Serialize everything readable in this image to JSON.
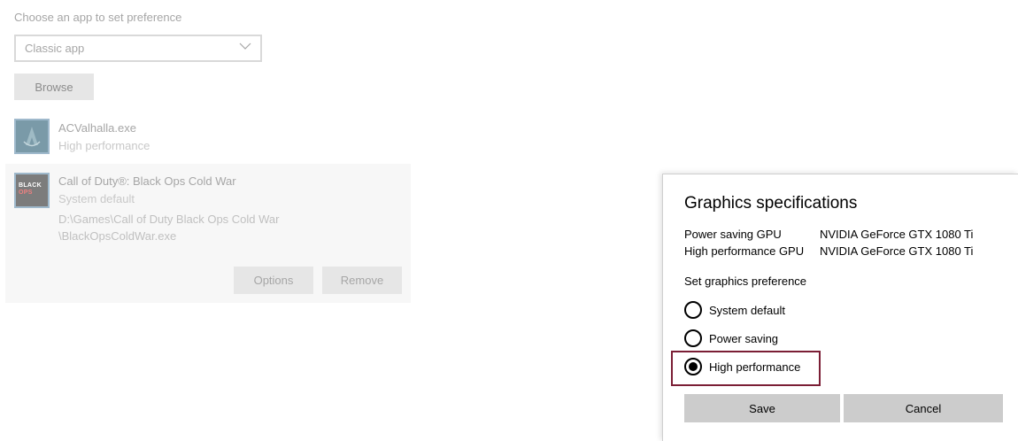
{
  "settings": {
    "choose_label": "Choose an app to set preference",
    "app_type_select": {
      "selected": "Classic app",
      "icon": "chevron-down-icon"
    },
    "browse_label": "Browse",
    "apps": [
      {
        "name": "ACValhalla.exe",
        "preference": "High performance",
        "icon": "assassins-creed-app-icon"
      },
      {
        "name": "Call of Duty®: Black Ops Cold War",
        "preference": "System default",
        "path_line1": "D:\\Games\\Call of Duty Black Ops Cold War",
        "path_line2": "\\BlackOpsColdWar.exe",
        "icon_text_top": "BLACK",
        "icon_text_bottom": "OPS",
        "options_label": "Options",
        "remove_label": "Remove"
      }
    ]
  },
  "dialog": {
    "title": "Graphics specifications",
    "specs": [
      {
        "key": "Power saving GPU",
        "value": "NVIDIA GeForce GTX 1080 Ti"
      },
      {
        "key": "High performance GPU",
        "value": "NVIDIA GeForce GTX 1080 Ti"
      }
    ],
    "pref_label": "Set graphics preference",
    "options": [
      {
        "label": "System default",
        "selected": false
      },
      {
        "label": "Power saving",
        "selected": false
      },
      {
        "label": "High performance",
        "selected": true
      }
    ],
    "save_label": "Save",
    "cancel_label": "Cancel",
    "highlight_color": "#7b1e35"
  }
}
